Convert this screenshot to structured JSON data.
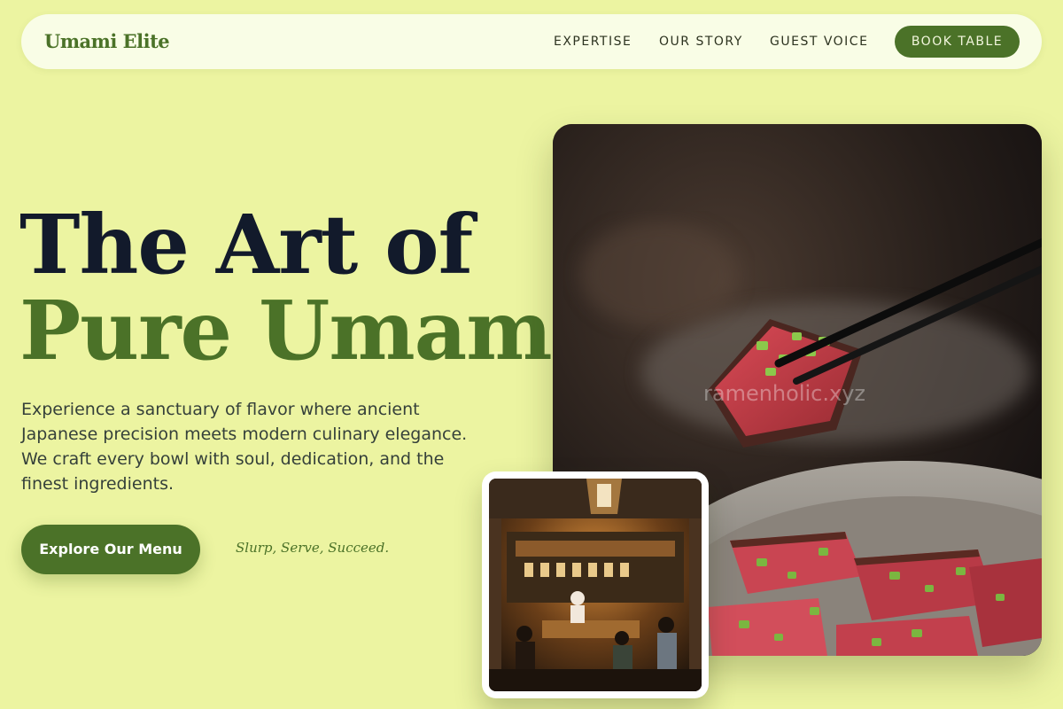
{
  "brand": {
    "name": "Umami Elite"
  },
  "nav": {
    "links": [
      "EXPERTISE",
      "OUR STORY",
      "GUEST VOICE"
    ],
    "cta_label": "BOOK TABLE"
  },
  "hero": {
    "headline_line1": "The Art of",
    "headline_line2": "Pure Umami.",
    "description": "Experience a sanctuary of flavor where ancient Japanese precision meets modern culinary elegance. We craft every bowl with soul, dedication, and the finest ingredients.",
    "cta_label": "Explore Our Menu",
    "tagline": "Slurp, Serve, Succeed."
  },
  "images": {
    "main": {
      "subject": "seared beef slice held with chopsticks over a plate",
      "watermark": "ramenholic.xyz"
    },
    "inset": {
      "subject": "warm-lit Japanese restaurant interior with chef and guests"
    }
  },
  "colors": {
    "background": "#ecf4a1",
    "nav_bg": "#f9fde6",
    "accent": "#4b7228",
    "headline_dark": "#121a2b",
    "body_text": "#35403a"
  }
}
